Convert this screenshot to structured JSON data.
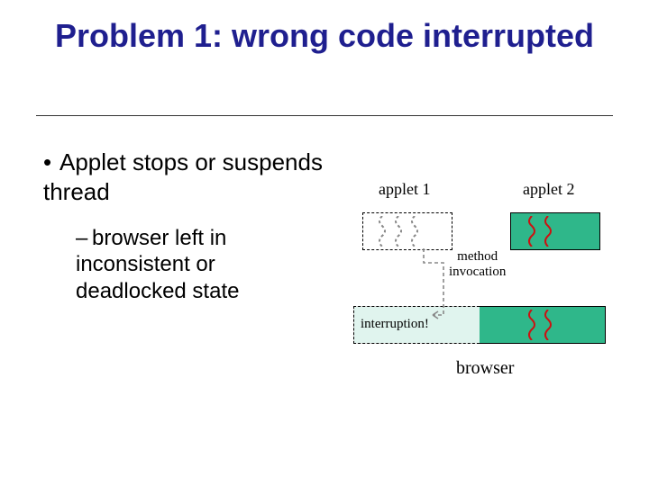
{
  "title": "Problem 1: wrong code interrupted",
  "bullets": {
    "main": "Applet stops or suspends thread",
    "sub": "browser left in inconsistent or deadlocked state"
  },
  "diagram": {
    "applet1_label": "applet 1",
    "applet2_label": "applet 2",
    "method_label": "method\ninvocation",
    "interrupt_label": "interruption!",
    "browser_label": "browser"
  },
  "colors": {
    "title": "#1f1f8f",
    "thread_box": "#2fb78a",
    "thread_live": "#cc1111",
    "thread_dead": "#888888"
  }
}
